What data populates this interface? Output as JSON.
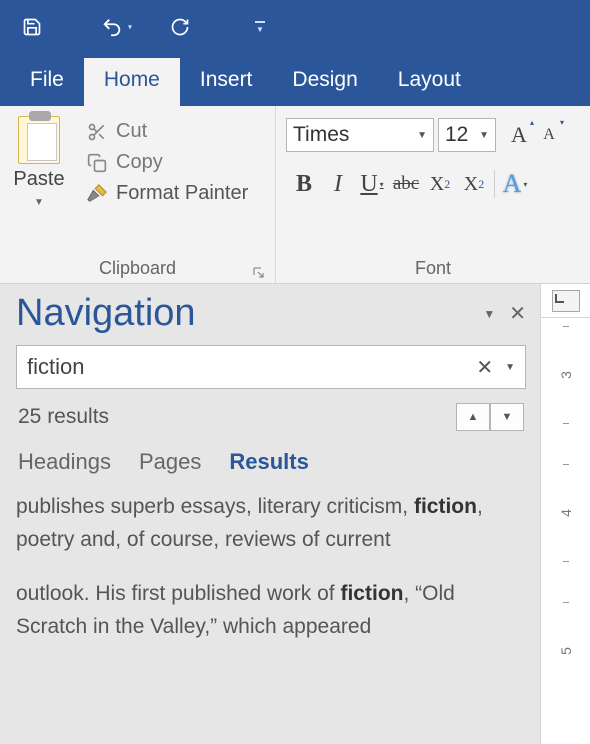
{
  "qat": {
    "save": "save",
    "undo": "undo",
    "repeat": "repeat"
  },
  "tabs": {
    "file": "File",
    "home": "Home",
    "insert": "Insert",
    "design": "Design",
    "layout": "Layout"
  },
  "ribbon": {
    "clipboard": {
      "paste": "Paste",
      "cut": "Cut",
      "copy": "Copy",
      "formatPainter": "Format Painter",
      "groupLabel": "Clipboard"
    },
    "font": {
      "fontName": "Times",
      "fontSize": "12",
      "growLabel": "A",
      "shrinkLabel": "A",
      "bold": "B",
      "italic": "I",
      "underline": "U",
      "strike": "abc",
      "subscript": "X",
      "subscriptSub": "2",
      "superscript": "X",
      "superscriptSup": "2",
      "texteffect": "A",
      "groupLabel": "Font"
    }
  },
  "navigation": {
    "title": "Navigation",
    "search": {
      "value": "fiction"
    },
    "resultsCount": "25 results",
    "tabs": {
      "headings": "Headings",
      "pages": "Pages",
      "results": "Results"
    },
    "snippets": [
      {
        "pre": "publishes superb essays, literary criticism, ",
        "match": "fiction",
        "post": ", poetry and, of course, reviews of current"
      },
      {
        "pre": "outlook.  His first published work of ",
        "match": "fiction",
        "post": ", “Old Scratch in the Valley,” which appeared"
      }
    ]
  },
  "ruler": {
    "marks": [
      "3",
      "4",
      "5"
    ]
  }
}
